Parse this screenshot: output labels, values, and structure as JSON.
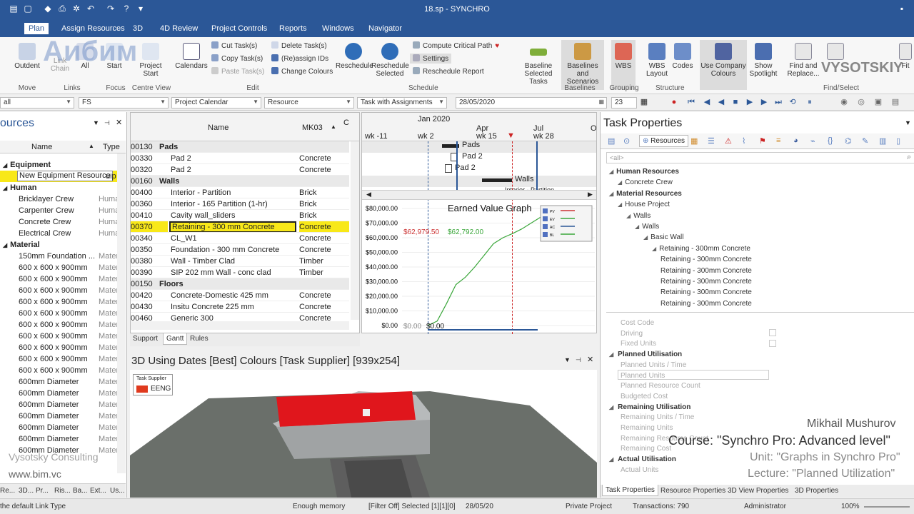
{
  "app": {
    "title": "18.sp - SYNCHRO"
  },
  "menu": [
    "Plan",
    "Assign Resources",
    "3D",
    "4D Review",
    "Project Controls",
    "Reports",
    "Windows",
    "Navigator"
  ],
  "ribbon": {
    "left_labels": [
      "Outdent",
      "Link",
      "Chain",
      "All"
    ],
    "start": "Start",
    "project_start": "Project Start",
    "calendars": "Calendars",
    "cut": "Cut Task(s)",
    "copy": "Copy Task(s)",
    "paste": "Paste Task(s)",
    "delete": "Delete Task(s)",
    "reassign": "(Re)assign IDs",
    "colours": "Change Colours",
    "critical": "Compute Critical Path",
    "settings": "Settings",
    "reschedule_report": "Reschedule Report",
    "reschedule": "Reschedule",
    "reschedule_selected": "Reschedule Selected",
    "baseline_selected": "Baseline Selected Tasks",
    "baselines_scenarios": "Baselines and Scenarios",
    "wbs": "WBS",
    "wbs_layout": "WBS Layout",
    "codes": "Codes",
    "company_colours": "Use Company Colours",
    "spotlight": "Show Spotlight",
    "find_replace": "Find and Replace...",
    "fit": "Fit",
    "groups": [
      "Move",
      "Links",
      "Focus",
      "Centre View",
      "Edit",
      "Schedule",
      "Baselines",
      "Grouping",
      "Structure",
      "Find/Select"
    ]
  },
  "filterbar": {
    "all": "all",
    "link_type": "FS",
    "calendar": "Project Calendar",
    "resource": "Resource",
    "assignments": "Task with Assignments",
    "date": "28/05/2020",
    "zoom": "23"
  },
  "resources": {
    "title": "ources",
    "col_name": "Name",
    "col_type": "Type",
    "equipment_group": "Equipment",
    "new_item": "New Equipment Resource",
    "new_item_type": "uip",
    "human_group": "Human",
    "human": [
      {
        "name": "Bricklayer Crew",
        "type": "Huma"
      },
      {
        "name": "Carpenter Crew",
        "type": "Huma"
      },
      {
        "name": "Concrete Crew",
        "type": "Huma"
      },
      {
        "name": "Electrical Crew",
        "type": "Huma"
      }
    ],
    "material_group": "Material",
    "materials": [
      {
        "name": "150mm Foundation ...",
        "type": "Mater"
      },
      {
        "name": "600 x 600 x 900mm",
        "type": "Mater"
      },
      {
        "name": "600 x 600 x 900mm",
        "type": "Mater"
      },
      {
        "name": "600 x 600 x 900mm",
        "type": "Mater"
      },
      {
        "name": "600 x 600 x 900mm",
        "type": "Mater"
      },
      {
        "name": "600 x 600 x 900mm",
        "type": "Mater"
      },
      {
        "name": "600 x 600 x 900mm",
        "type": "Mater"
      },
      {
        "name": "600 x 600 x 900mm",
        "type": "Mater"
      },
      {
        "name": "600 x 600 x 900mm",
        "type": "Mater"
      },
      {
        "name": "600 x 600 x 900mm",
        "type": "Mater"
      },
      {
        "name": "600 x 600 x 900mm",
        "type": "Mater"
      },
      {
        "name": "600mm Diameter",
        "type": "Mater"
      },
      {
        "name": "600mm Diameter",
        "type": "Mater"
      },
      {
        "name": "600mm Diameter",
        "type": "Mater"
      },
      {
        "name": "600mm Diameter",
        "type": "Mater"
      },
      {
        "name": "600mm Diameter",
        "type": "Mater"
      },
      {
        "name": "600mm Diameter",
        "type": "Mater"
      },
      {
        "name": "600mm Diameter",
        "type": "Mater"
      }
    ],
    "bottom_tabs": [
      "Re...",
      "3D...",
      "Pr...",
      "Ris...",
      "Ba...",
      "Ext...",
      "Us..."
    ]
  },
  "tasks": {
    "col_name": "Name",
    "col_mk": "MK03",
    "col_c": "C",
    "rows": [
      {
        "id": "00130",
        "name": "Pads",
        "mk": "",
        "group": true
      },
      {
        "id": "00330",
        "name": "Pad 2",
        "mk": "Concrete",
        "group": false
      },
      {
        "id": "00320",
        "name": "Pad 2",
        "mk": "Concrete",
        "group": false
      },
      {
        "id": "00160",
        "name": "Walls",
        "mk": "",
        "group": true
      },
      {
        "id": "00400",
        "name": "Interior - Partition",
        "mk": "Brick",
        "group": false
      },
      {
        "id": "00360",
        "name": "Interior - 165 Partition (1-hr)",
        "mk": "Brick",
        "group": false
      },
      {
        "id": "00410",
        "name": "Cavity wall_sliders",
        "mk": "Brick",
        "group": false
      },
      {
        "id": "00370",
        "name": "Retaining - 300 mm Concrete",
        "mk": "Concrete",
        "group": false,
        "selected": true
      },
      {
        "id": "00340",
        "name": "CL_W1",
        "mk": "Concrete",
        "group": false
      },
      {
        "id": "00350",
        "name": "Foundation - 300 mm Concrete",
        "mk": "Concrete",
        "group": false
      },
      {
        "id": "00380",
        "name": "Wall - Timber Clad",
        "mk": "Timber",
        "group": false
      },
      {
        "id": "00390",
        "name": "SIP 202 mm Wall - conc clad",
        "mk": "Timber",
        "group": false
      },
      {
        "id": "00150",
        "name": "Floors",
        "mk": "",
        "group": true
      },
      {
        "id": "00420",
        "name": "Concrete-Domestic 425 mm",
        "mk": "Concrete",
        "group": false
      },
      {
        "id": "00430",
        "name": "Insitu Concrete 225 mm",
        "mk": "Concrete",
        "group": false
      },
      {
        "id": "00460",
        "name": "Generic 300",
        "mk": "Concrete",
        "group": false
      }
    ],
    "tabs": [
      "Support",
      "Gantt",
      "Rules"
    ]
  },
  "gantt": {
    "month1": "Jan 2020",
    "month2": "Apr",
    "month3": "Jul",
    "month4": "O",
    "weeks": [
      "wk -11",
      "wk 2",
      "wk 15",
      "wk 28"
    ],
    "bars": [
      "Pads",
      "Pad 2",
      "Pad 2",
      "Walls",
      "Interior - Partition"
    ]
  },
  "chart_data": {
    "type": "line",
    "title": "Earned Value Graph",
    "y_ticks": [
      "$80,000.00",
      "$70,000.00",
      "$60,000.00",
      "$50,000.00",
      "$40,000.00",
      "$30,000.00",
      "$20,000.00",
      "$10,000.00",
      "$0.00"
    ],
    "ylim": [
      0,
      80000
    ],
    "legend": [
      "PV",
      "EV",
      "AC",
      "BL"
    ],
    "marker_labels": [
      "$62,979.50",
      "$62,792.00",
      "$0.00",
      "$0.00"
    ],
    "series": [
      {
        "name": "EV",
        "values": [
          0,
          3000,
          15000,
          28000,
          33000,
          40000,
          48000,
          56000,
          60000,
          62792,
          66000,
          70000,
          74000
        ]
      }
    ]
  },
  "view3d": {
    "title": "3D Using Dates [Best] Colours [Task Supplier]  [939x254]",
    "legend_title": "Task Supplier",
    "legend_item": "EENG",
    "legend_color": "#e03a1e"
  },
  "task_properties": {
    "title": "Task Properties",
    "tab_resources": "Resources",
    "filter": "<all>",
    "tree": [
      {
        "label": "Human Resources",
        "level": 0,
        "bold": true
      },
      {
        "label": "Concrete Crew",
        "level": 1,
        "bold": false
      },
      {
        "label": "Material Resources",
        "level": 0,
        "bold": true
      },
      {
        "label": "House Project",
        "level": 1,
        "bold": false
      },
      {
        "label": "Walls",
        "level": 2,
        "bold": false
      },
      {
        "label": "Walls",
        "level": 3,
        "bold": false
      },
      {
        "label": "Basic Wall",
        "level": 4,
        "bold": false
      },
      {
        "label": "Retaining - 300mm Concrete",
        "level": 5,
        "bold": false
      },
      {
        "label": "Retaining - 300mm Concrete",
        "level": 6,
        "bold": false
      },
      {
        "label": "Retaining - 300mm Concrete",
        "level": 6,
        "bold": false
      },
      {
        "label": "Retaining - 300mm Concrete",
        "level": 6,
        "bold": false
      },
      {
        "label": "Retaining - 300mm Concrete",
        "level": 6,
        "bold": false
      },
      {
        "label": "Retaining - 300mm Concrete",
        "level": 6,
        "bold": false
      }
    ],
    "props": [
      {
        "label": "Cost Code",
        "header": false
      },
      {
        "label": "Driving",
        "header": false
      },
      {
        "label": "Fixed Units",
        "header": false
      },
      {
        "label": "Planned Utilisation",
        "header": true
      },
      {
        "label": "Planned Units / Time",
        "header": false
      },
      {
        "label": "Planned Units",
        "header": false
      },
      {
        "label": "Planned Resource Count",
        "header": false
      },
      {
        "label": "Budgeted Cost",
        "header": false
      },
      {
        "label": "Remaining Utilisation",
        "header": true
      },
      {
        "label": "Remaining Units / Time",
        "header": false
      },
      {
        "label": "Remaining Units",
        "header": false
      },
      {
        "label": "Remaining Resource Count",
        "header": false
      },
      {
        "label": "Remaining Cost",
        "header": false
      },
      {
        "label": "Actual Utilisation",
        "header": true
      },
      {
        "label": "Actual Units",
        "header": false
      }
    ],
    "bottom_tabs": [
      "Task Properties",
      "Resource Properties",
      "3D View Properties",
      "3D Properties"
    ]
  },
  "watermark": {
    "author": "Mikhail Mushurov",
    "course": "Course: \"Synchro Pro: Advanced level\"",
    "unit": "Unit: \"Graphs in Synchro Pro\"",
    "lecture": "Lecture: \"Planned Utilization\"",
    "brand_left": "Vysotsky Consulting",
    "site": "www.bim.vc",
    "logo_top": "Аибим",
    "logo_right": "VYSOTSKIY"
  },
  "status": {
    "hint": "the default Link Type",
    "memory": "Enough memory",
    "filter": "[Filter Off]  Selected [1][1][0]",
    "date": "28/05/20",
    "project": "Private Project",
    "transactions": "Transactions: 790",
    "user": "Administrator",
    "zoom": "100%"
  }
}
